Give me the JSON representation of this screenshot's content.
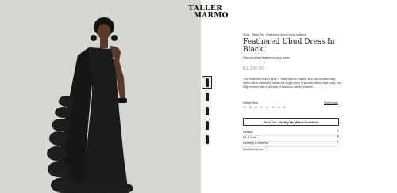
{
  "brand": {
    "line1": "TALLER",
    "line2": "MARMO"
  },
  "breadcrumb": "Shop - Black Tie - Feathered Ubud Dress In Black",
  "product": {
    "title": "Feathered Ubud Dress In Black",
    "subtitle": "One-shoulder feathered long dress",
    "price": "€2.100,00",
    "description": "The Feathered Ubud Dress, a Taller Marmo Classic, is a one-shoulder long dress with a relaxed fit, made of a single piece of viscose-blend crepe cady, and fully trimmed with a soft lace of luxurious ostrich feathers."
  },
  "size": {
    "label": "Select Size",
    "guide": "Size Guide",
    "options": [
      "36",
      "38",
      "40",
      "42",
      "44",
      "46",
      "48",
      "50"
    ]
  },
  "sold_out_button": "Sold Out - Notify Me When Available",
  "accordion": [
    {
      "label": "Details",
      "icon": "+"
    },
    {
      "label": "Fit & Care",
      "icon": "+"
    },
    {
      "label": "Delivery & Returns",
      "icon": "+"
    }
  ],
  "wishlist": {
    "label": "Add to Wishlist",
    "icon": "heart-icon"
  },
  "thumbnails_count": 6,
  "colors": {
    "hero_bg": "#d7d6d0",
    "dress": "#1b1b1b",
    "price": "#999999"
  }
}
